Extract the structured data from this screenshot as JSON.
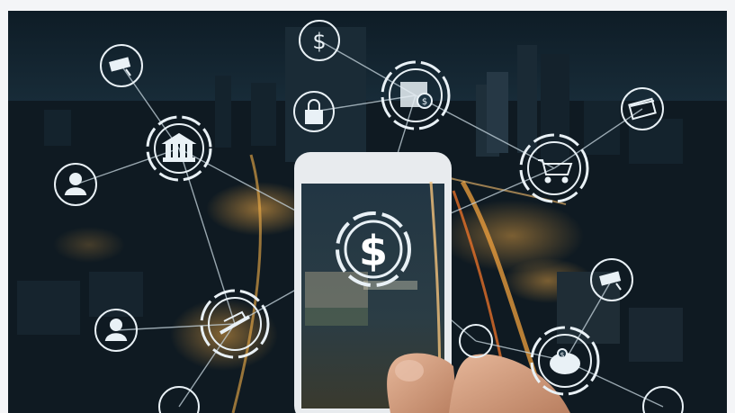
{
  "photo": {
    "subject": "fintech-city-network",
    "palette": {
      "sky_top": "#0e1c26",
      "sky_bottom": "#1d3442",
      "city_dark": "#0c151d",
      "city_light_warm": "#f3a23a",
      "city_light_cool": "#cfe3ff",
      "icon_stroke": "#e9f1f6",
      "network_line": "#c7d6df",
      "phone_body": "#e8ebee",
      "screen_tint": "#1b2f3b",
      "hand_skin": "#d9a98c"
    },
    "icons": [
      "cctv-icon",
      "dollar-icon",
      "bank-icon",
      "user-icon",
      "lock-icon",
      "atm-cash-icon",
      "credit-card-icon",
      "shopping-cart-icon",
      "dollar-icon",
      "user-icon",
      "money-transfer-icon",
      "cctv-icon",
      "piggy-bank-icon"
    ]
  }
}
